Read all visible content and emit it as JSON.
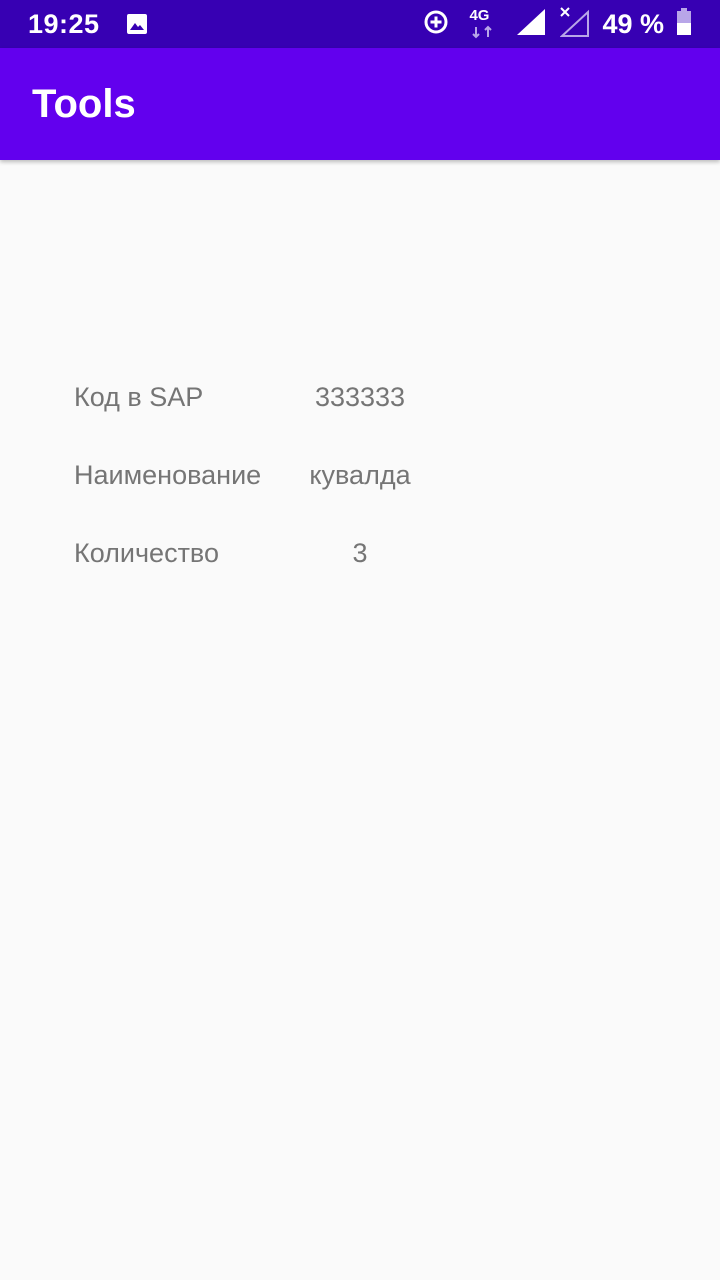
{
  "status_bar": {
    "time": "19:25",
    "network_label": "4G",
    "battery_percent": "49 %",
    "battery_level": 0.49,
    "icons": [
      "image-icon",
      "data-saver-icon",
      "network-4g-icon",
      "signal-icon",
      "signal-no-service-icon",
      "battery-icon"
    ]
  },
  "app_bar": {
    "title": "Tools"
  },
  "details": [
    {
      "label": "Код в SAP",
      "value": "333333"
    },
    {
      "label": "Наименование",
      "value": "кувалда"
    },
    {
      "label": "Количество",
      "value": "3"
    }
  ],
  "colors": {
    "status_bar": "#3700b3",
    "app_bar": "#6200ee",
    "background": "#fafafa",
    "text": "#757575"
  }
}
